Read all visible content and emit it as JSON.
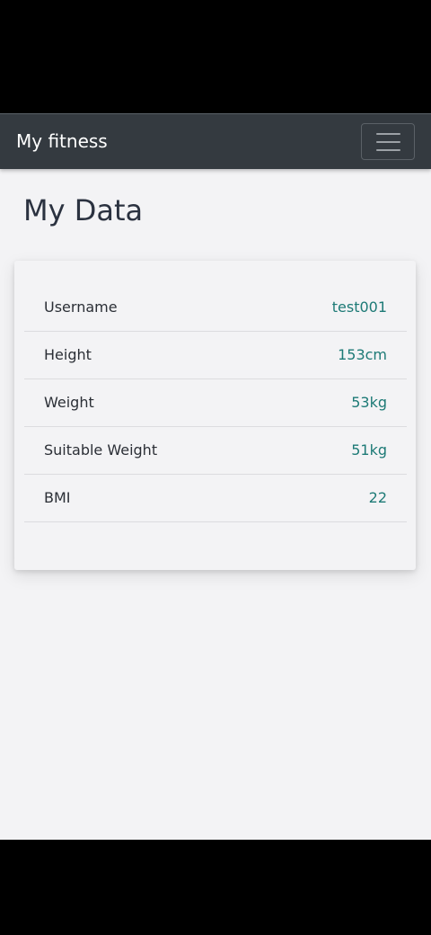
{
  "navbar": {
    "brand": "My fitness",
    "menu_icon": "hamburger-menu-icon"
  },
  "page": {
    "title": "My Data"
  },
  "profile": {
    "rows": [
      {
        "label": "Username",
        "value": "test001"
      },
      {
        "label": "Height",
        "value": "153cm"
      },
      {
        "label": "Weight",
        "value": "53kg"
      },
      {
        "label": "Suitable Weight",
        "value": "51kg"
      },
      {
        "label": "BMI",
        "value": "22"
      }
    ]
  },
  "colors": {
    "navbar_bg": "#343a40",
    "page_bg": "#f3f3f5",
    "value_accent": "#1d7a76",
    "title_text": "#2b3240"
  }
}
